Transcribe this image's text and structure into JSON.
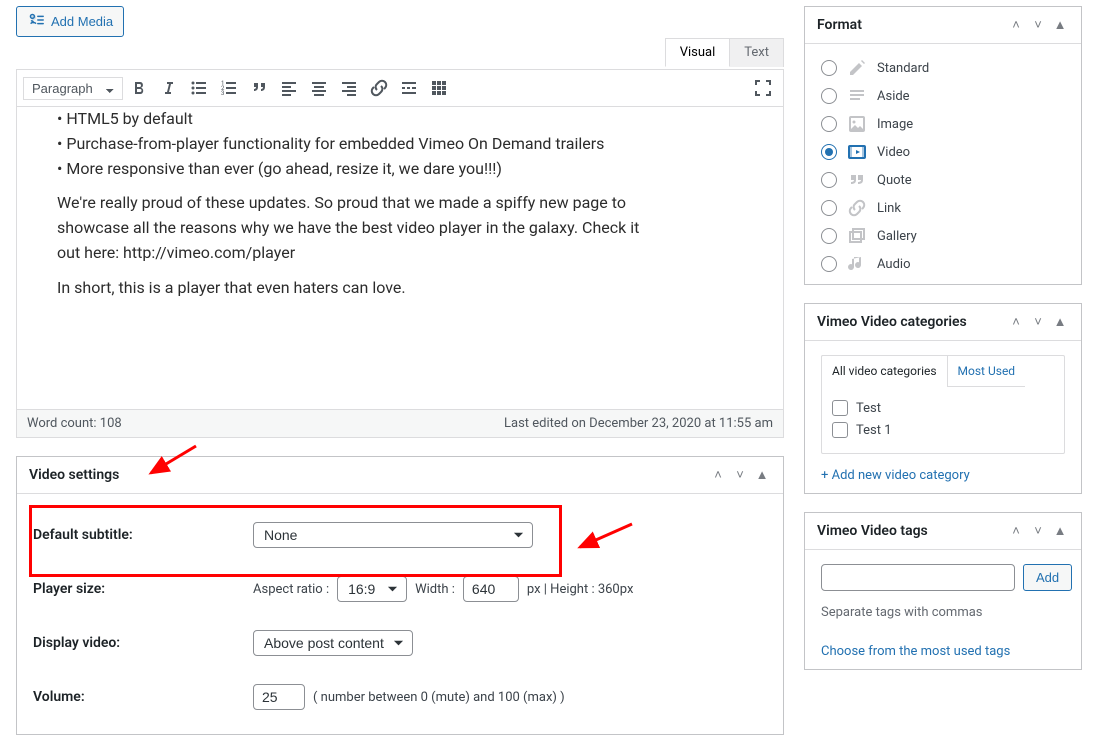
{
  "media_button": "Add Media",
  "editor": {
    "tabs": {
      "visual": "Visual",
      "text": "Text"
    },
    "paragraph_label": "Paragraph",
    "content_lines": [
      "• HTML5 by default",
      "• Purchase-from-player functionality for embedded Vimeo On Demand trailers",
      "• More responsive than ever (go ahead, resize it, we dare you!!!)"
    ],
    "content_p2": "We're really proud of these updates. So proud that we made a spiffy new page to showcase all the reasons why we have the best video player in the galaxy. Check it out here: http://vimeo.com/player",
    "content_p3": "In short, this is a player that even haters can love.",
    "word_count": "Word count: 108",
    "last_edited": "Last edited on December 23, 2020 at 11:55 am"
  },
  "video_settings": {
    "title": "Video settings",
    "rows": {
      "default_subtitle": {
        "label": "Default subtitle:",
        "value": "None"
      },
      "player_size": {
        "label": "Player size:",
        "aspect_label": "Aspect ratio :",
        "aspect_value": "16:9",
        "width_label": "Width :",
        "width_value": "640",
        "px_height": "px | Height : 360px"
      },
      "display_video": {
        "label": "Display video:",
        "value": "Above post content"
      },
      "volume": {
        "label": "Volume:",
        "value": "25",
        "hint": "( number between 0 (mute) and 100 (max) )"
      }
    }
  },
  "format": {
    "title": "Format",
    "options": [
      {
        "key": "standard",
        "label": "Standard",
        "checked": false
      },
      {
        "key": "aside",
        "label": "Aside",
        "checked": false
      },
      {
        "key": "image",
        "label": "Image",
        "checked": false
      },
      {
        "key": "video",
        "label": "Video",
        "checked": true
      },
      {
        "key": "quote",
        "label": "Quote",
        "checked": false
      },
      {
        "key": "link",
        "label": "Link",
        "checked": false
      },
      {
        "key": "gallery",
        "label": "Gallery",
        "checked": false
      },
      {
        "key": "audio",
        "label": "Audio",
        "checked": false
      }
    ]
  },
  "categories": {
    "title": "Vimeo Video categories",
    "tabs": {
      "all": "All video categories",
      "most": "Most Used"
    },
    "items": [
      "Test",
      "Test 1"
    ],
    "add_link": "+ Add new video category"
  },
  "tags": {
    "title": "Vimeo Video tags",
    "add_button": "Add",
    "hint": "Separate tags with commas",
    "choose_link": "Choose from the most used tags"
  }
}
